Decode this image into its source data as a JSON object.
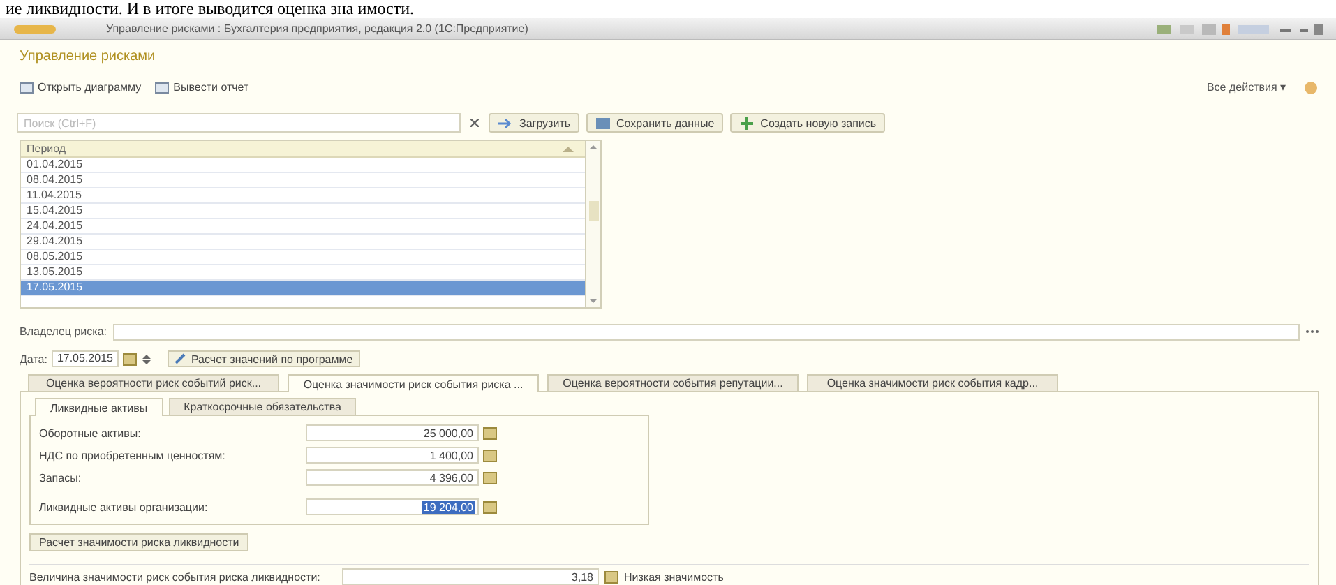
{
  "document_text": "ие ликвидности. И в итоге выводится оценка зна имости.",
  "window": {
    "title": "Управление рисками : Бухгалтерия предприятия, редакция 2.0 (1С:Предприятие)"
  },
  "form": {
    "title": "Управление рисками",
    "all_actions": "Все действия ▾"
  },
  "toolbar": [
    "Открыть диаграмму",
    "Вывести отчет"
  ],
  "search": {
    "placeholder": "Поиск (Ctrl+F)"
  },
  "actions": [
    {
      "kind": "load",
      "label": "Загрузить"
    },
    {
      "kind": "save",
      "label": "Сохранить данные"
    },
    {
      "kind": "add",
      "label": "Создать новую запись"
    }
  ],
  "table": {
    "columns": [
      "Период"
    ],
    "rows": [
      {
        "period": "01.04.2015",
        "selected": false
      },
      {
        "period": "08.04.2015",
        "selected": false
      },
      {
        "period": "11.04.2015",
        "selected": false
      },
      {
        "period": "15.04.2015",
        "selected": false
      },
      {
        "period": "24.04.2015",
        "selected": false
      },
      {
        "period": "29.04.2015",
        "selected": false
      },
      {
        "period": "08.05.2015",
        "selected": false
      },
      {
        "period": "13.05.2015",
        "selected": false
      },
      {
        "period": "17.05.2015",
        "selected": true
      }
    ]
  },
  "owner": {
    "label": "Владелец риска:"
  },
  "date": {
    "label": "Дата:",
    "value": "17.05.2015",
    "calc_button": "Расчет значений по программе"
  },
  "tabs": [
    {
      "label": "Оценка вероятности риск событий риск...",
      "selected": false
    },
    {
      "label": "Оценка значимости риск события риска ...",
      "selected": true
    },
    {
      "label": "Оценка вероятности события репутации...",
      "selected": false
    },
    {
      "label": "Оценка значимости риск события кадр...",
      "selected": false
    }
  ],
  "inner_tabs": [
    {
      "label": "Ликвидные активы",
      "selected": true
    },
    {
      "label": "Краткосрочные обязательства",
      "selected": false
    }
  ],
  "fields": [
    {
      "label": "Оборотные активы:",
      "value": "25 000,00",
      "highlighted": false
    },
    {
      "label": "НДС по приобретенным ценностям:",
      "value": "1 400,00",
      "highlighted": false
    },
    {
      "label": "Запасы:",
      "value": "4 396,00",
      "highlighted": false
    },
    {
      "label": "Ликвидные активы организации:",
      "value": "19 204,00",
      "highlighted": true
    }
  ],
  "liquidity_button": "Расчет значимости риска ликвидности",
  "result": {
    "label": "Величина значимости риск события риска ликвидности:",
    "value": "3,18",
    "note": "Низкая значимость"
  }
}
